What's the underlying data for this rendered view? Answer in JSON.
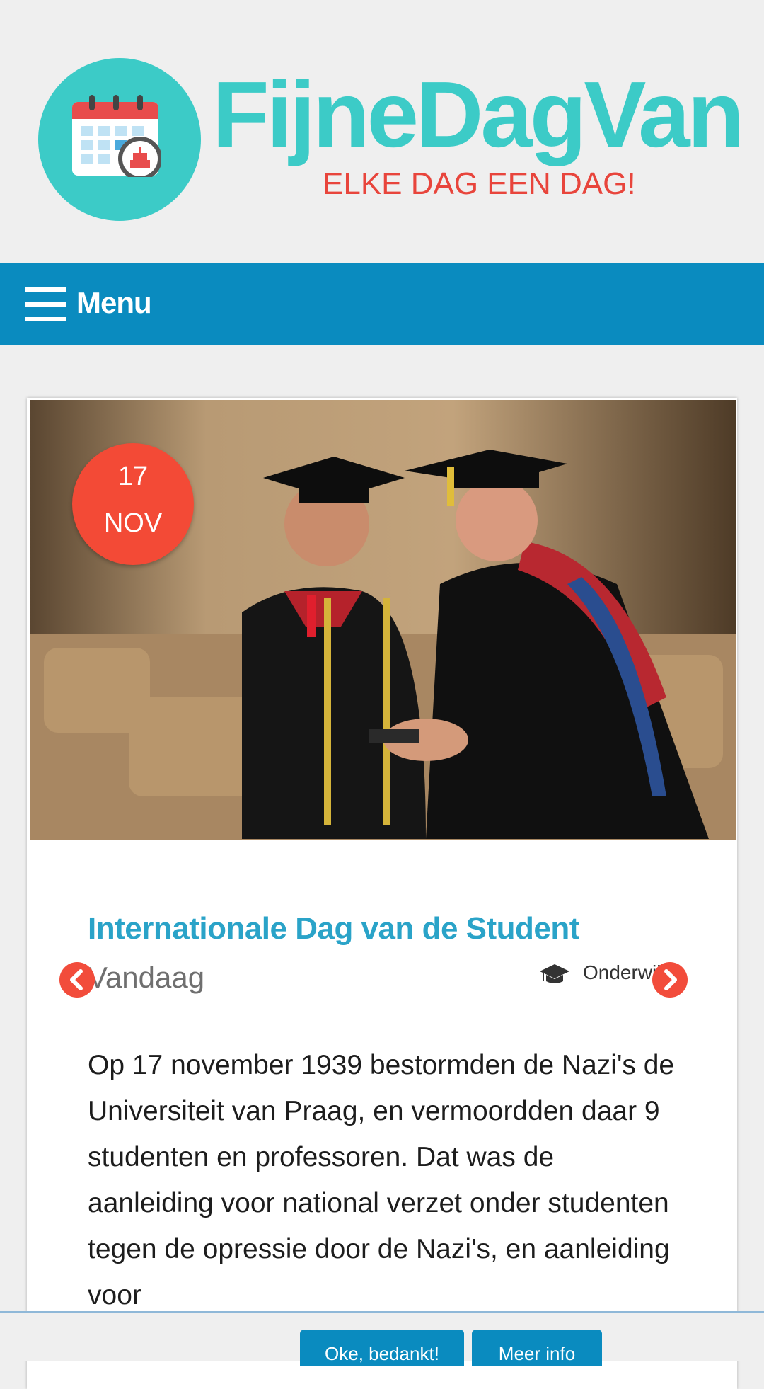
{
  "brand": {
    "name": "FijneDagVan",
    "tagline": "ELKE DAG EEN DAG!",
    "colors": {
      "primary": "#3ccbc7",
      "accent": "#e8453c"
    }
  },
  "nav": {
    "menu_label": "Menu",
    "menu_icon": "hamburger-icon",
    "bar_color": "#0a8bbf"
  },
  "article": {
    "date": {
      "day": "17",
      "month": "NOV"
    },
    "title": "Internationale Dag van de Student",
    "when": "Vandaag",
    "category": {
      "label": "Onderwijs",
      "icon": "graduation-cap-icon"
    },
    "body": "Op 17 november 1939 bestormden de Nazi's de Universiteit van Praag, en vermoordden daar 9 studenten en professoren. Dat was de aanleiding voor national verzet onder studenten tegen de opressie door de Nazi's, en aanleiding voor",
    "prev_icon": "chevron-left-icon",
    "next_icon": "chevron-right-icon",
    "arrow_color": "#f24c3b",
    "title_color": "#2aa3c8"
  },
  "cookie_bar": {
    "accept_label": "Oke, bedankt!",
    "info_label": "Meer info"
  }
}
